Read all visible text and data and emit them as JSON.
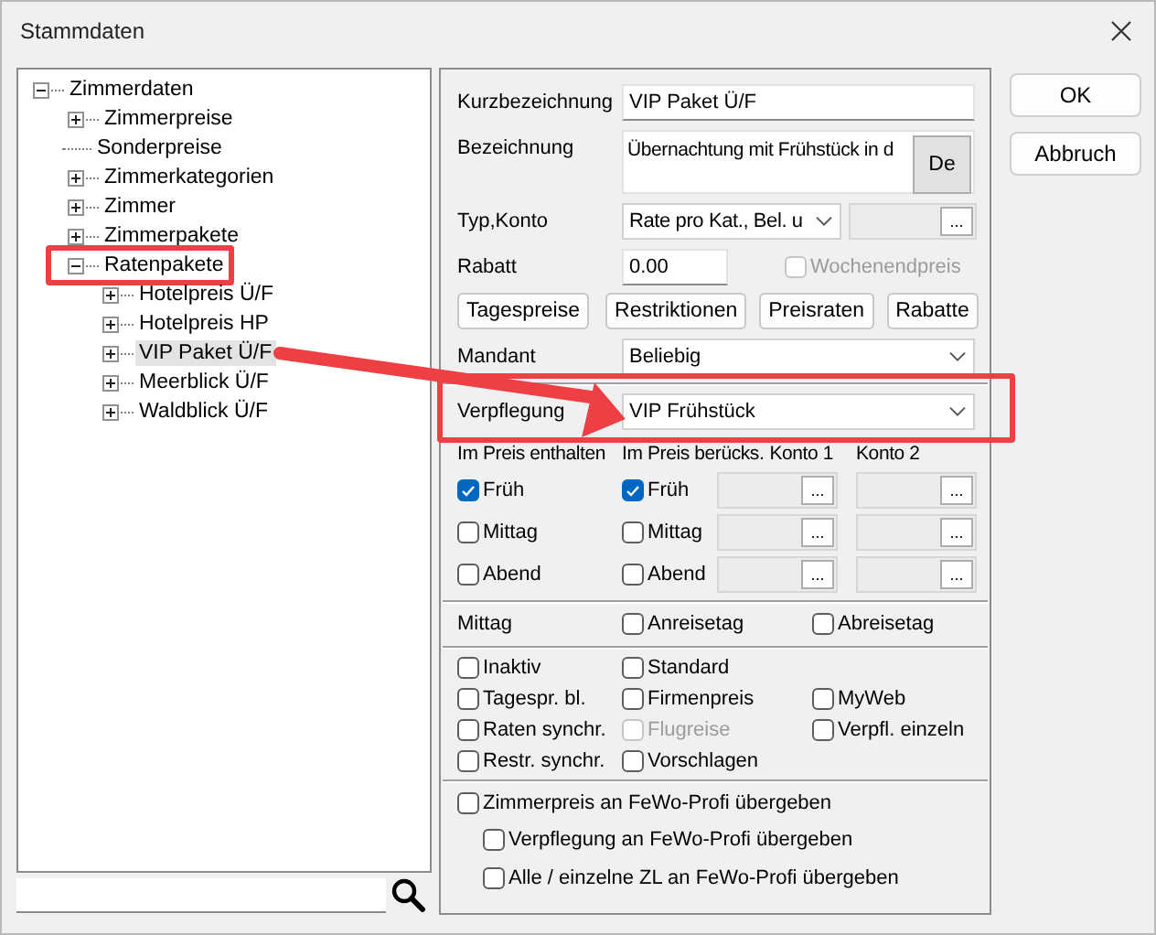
{
  "window": {
    "title": "Stammdaten"
  },
  "tree": {
    "items": [
      {
        "label": "Zimmerdaten",
        "expandable": true,
        "expanded": true,
        "selected": false,
        "highlighted": false,
        "children": [
          {
            "label": "Zimmerpreise",
            "expandable": true,
            "expanded": false,
            "selected": false,
            "highlighted": false
          },
          {
            "label": "Sonderpreise",
            "expandable": false,
            "selected": false,
            "highlighted": false
          },
          {
            "label": "Zimmerkategorien",
            "expandable": true,
            "expanded": false,
            "selected": false,
            "highlighted": false
          },
          {
            "label": "Zimmer",
            "expandable": true,
            "expanded": false,
            "selected": false,
            "highlighted": false
          },
          {
            "label": "Zimmerpakete",
            "expandable": true,
            "expanded": false,
            "selected": false,
            "highlighted": false
          },
          {
            "label": "Ratenpakete",
            "expandable": true,
            "expanded": true,
            "selected": false,
            "highlighted": true,
            "children": [
              {
                "label": "Hotelpreis Ü/F",
                "expandable": true,
                "expanded": false,
                "selected": false,
                "highlighted": false
              },
              {
                "label": "Hotelpreis HP",
                "expandable": true,
                "expanded": false,
                "selected": false,
                "highlighted": false
              },
              {
                "label": "VIP Paket Ü/F",
                "expandable": true,
                "expanded": false,
                "selected": true,
                "highlighted": false
              },
              {
                "label": "Meerblick Ü/F",
                "expandable": true,
                "expanded": false,
                "selected": false,
                "highlighted": false
              },
              {
                "label": "Waldblick Ü/F",
                "expandable": true,
                "expanded": false,
                "selected": false,
                "highlighted": false
              }
            ]
          }
        ]
      }
    ]
  },
  "form": {
    "kurzbezeichnung": {
      "label": "Kurzbezeichnung",
      "value": "VIP Paket Ü/F"
    },
    "bezeichnung": {
      "label": "Bezeichnung",
      "value": "Übernachtung mit Frühstück in d",
      "language_button": "De"
    },
    "typ_konto": {
      "label": "Typ,Konto",
      "value": "Rate pro Kat., Bel. u",
      "account_button": "..."
    },
    "rabatt": {
      "label": "Rabatt",
      "value": "0.00"
    },
    "wochenendpreis": {
      "label": "Wochenendpreis",
      "checked": false,
      "disabled": true
    },
    "buttons": [
      "Tagespreise",
      "Restriktionen",
      "Preisraten",
      "Rabatte"
    ],
    "mandant": {
      "label": "Mandant",
      "value": "Beliebig"
    },
    "verpflegung": {
      "label": "Verpflegung",
      "value": "VIP Frühstück",
      "highlighted": true
    },
    "meals": {
      "headers": [
        "Im Preis enthalten",
        "Im Preis berücks.",
        "Konto 1",
        "Konto 2"
      ],
      "rows": [
        {
          "included": {
            "label": "Früh",
            "checked": true
          },
          "considered": {
            "label": "Früh",
            "checked": true
          },
          "konto_1_button": "...",
          "konto_2_button": "..."
        },
        {
          "included": {
            "label": "Mittag",
            "checked": false
          },
          "considered": {
            "label": "Mittag",
            "checked": false
          },
          "konto_1_button": "...",
          "konto_2_button": "..."
        },
        {
          "included": {
            "label": "Abend",
            "checked": false
          },
          "considered": {
            "label": "Abend",
            "checked": false
          },
          "konto_1_button": "...",
          "konto_2_button": "..."
        }
      ]
    },
    "mittag": {
      "label": "Mittag",
      "options": [
        {
          "label": "Anreisetag",
          "checked": false
        },
        {
          "label": "Abreisetag",
          "checked": false
        }
      ]
    },
    "flags": [
      [
        {
          "label": "Inaktiv",
          "checked": false,
          "disabled": false
        },
        {
          "label": "Standard",
          "checked": false,
          "disabled": false
        }
      ],
      [
        {
          "label": "Tagespr. bl.",
          "checked": false,
          "disabled": false
        },
        {
          "label": "Firmenpreis",
          "checked": false,
          "disabled": false
        },
        {
          "label": "MyWeb",
          "checked": false,
          "disabled": false
        }
      ],
      [
        {
          "label": "Raten synchr.",
          "checked": false,
          "disabled": false
        },
        {
          "label": "Flugreise",
          "checked": false,
          "disabled": true
        },
        {
          "label": "Verpfl. einzeln",
          "checked": false,
          "disabled": false
        }
      ],
      [
        {
          "label": "Restr. synchr.",
          "checked": false,
          "disabled": false
        },
        {
          "label": "Vorschlagen",
          "checked": false,
          "disabled": false
        }
      ]
    ],
    "fewo": [
      {
        "label": "Zimmerpreis an FeWo-Profi übergeben",
        "checked": false,
        "children": [
          {
            "label": "Verpflegung an FeWo-Profi übergeben",
            "checked": false
          },
          {
            "label": "Alle / einzelne ZL an FeWo-Profi übergeben",
            "checked": false
          }
        ]
      }
    ]
  },
  "buttons": [
    {
      "label": "OK"
    },
    {
      "label": "Abbruch"
    }
  ],
  "annotations": [
    {
      "kind": "arrow"
    }
  ]
}
